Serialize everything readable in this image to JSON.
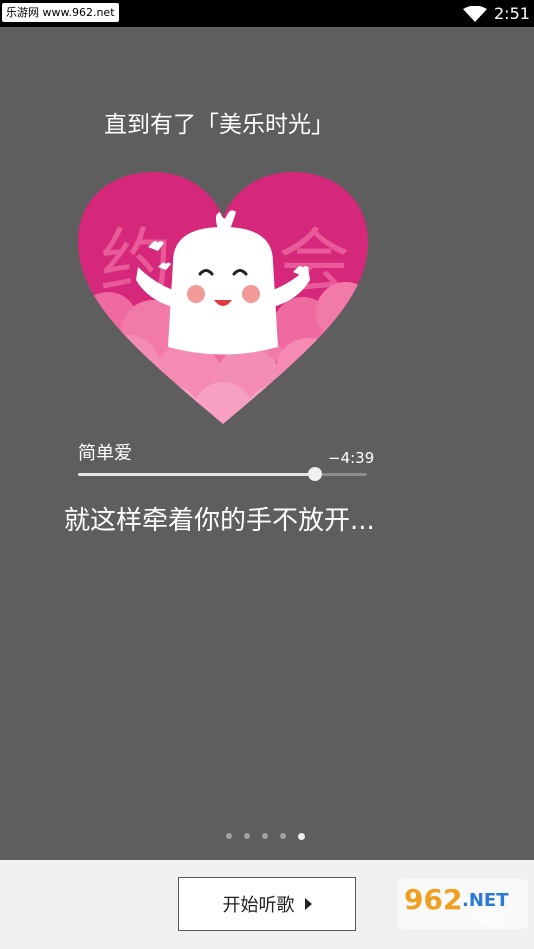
{
  "status_bar": {
    "watermark": "乐游网 www.962.net",
    "time": "2:51"
  },
  "onboarding": {
    "headline": "直到有了「美乐时光」",
    "heart_text_left": "约",
    "heart_text_right": "会",
    "page_count": 5,
    "active_page": 5
  },
  "player": {
    "song_title": "简单爱",
    "time_remaining": "−4:39",
    "progress": 0.82
  },
  "lyric": "就这样牵着你的手不放开...",
  "bottom": {
    "start_button_label": "开始听歌"
  },
  "logo": {
    "brand_text": "962",
    "brand_suffix": ".NET",
    "brand_sub": "乐游网"
  },
  "colors": {
    "heart_pink": "#d6287a",
    "cloud_pink": "#f06a9c",
    "background": "#5e5e5e",
    "bottom_bar": "#f0f0f0"
  }
}
